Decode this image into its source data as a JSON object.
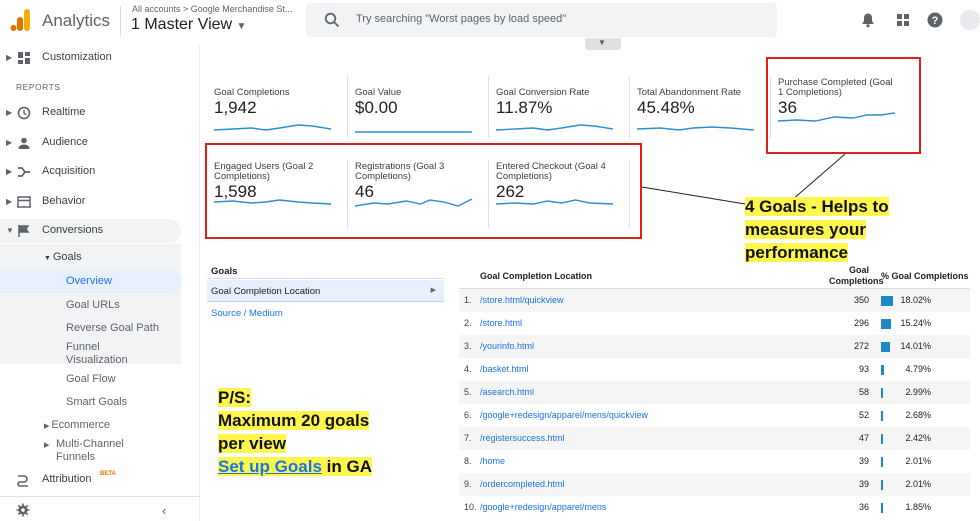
{
  "header": {
    "app_title": "Analytics",
    "breadcrumb": "All accounts  >  Google Merchandise St...",
    "view_name": "1 Master View",
    "search_placeholder": "Try searching \"Worst pages by load speed\""
  },
  "sidebar": {
    "customization": "Customization",
    "reports_heading": "REPORTS",
    "realtime": "Realtime",
    "audience": "Audience",
    "acquisition": "Acquisition",
    "behavior": "Behavior",
    "conversions": "Conversions",
    "goals": "Goals",
    "goal_items": [
      "Overview",
      "Goal URLs",
      "Reverse Goal Path",
      "Funnel Visualization",
      "Goal Flow",
      "Smart Goals"
    ],
    "ecommerce": "Ecommerce",
    "multi_channel": "Multi-Channel Funnels",
    "attribution": "Attribution",
    "beta": "BETA"
  },
  "metrics_row1": [
    {
      "title": "Goal Completions",
      "value": "1,942"
    },
    {
      "title": "Goal Value",
      "value": "$0.00"
    },
    {
      "title": "Goal Conversion Rate",
      "value": "11.87%"
    },
    {
      "title": "Total Abandonment Rate",
      "value": "45.48%"
    },
    {
      "title": "Purchase Completed (Goal 1 Completions)",
      "value": "36"
    }
  ],
  "metrics_row2": [
    {
      "title": "Engaged Users (Goal 2 Completions)",
      "value": "1,598"
    },
    {
      "title": "Registrations (Goal 3 Completions)",
      "value": "46"
    },
    {
      "title": "Entered Checkout (Goal 4 Completions)",
      "value": "262"
    }
  ],
  "left_panel": {
    "heading": "Goals",
    "selected": "Goal Completion Location",
    "link": "Source / Medium"
  },
  "table": {
    "col_location": "Goal Completion Location",
    "col_completions": "Goal Completions",
    "col_pct": "% Goal Completions",
    "rows": [
      {
        "n": "1.",
        "path": "/store.html/quickview",
        "value": "350",
        "pct": "18.02%",
        "frac": 0.1802
      },
      {
        "n": "2.",
        "path": "/store.html",
        "value": "296",
        "pct": "15.24%",
        "frac": 0.1524
      },
      {
        "n": "3.",
        "path": "/yourinfo.html",
        "value": "272",
        "pct": "14.01%",
        "frac": 0.1401
      },
      {
        "n": "4.",
        "path": "/basket.html",
        "value": "93",
        "pct": "4.79%",
        "frac": 0.0479
      },
      {
        "n": "5.",
        "path": "/asearch.html",
        "value": "58",
        "pct": "2.99%",
        "frac": 0.0299
      },
      {
        "n": "6.",
        "path": "/google+redesign/apparel/mens/quickview",
        "value": "52",
        "pct": "2.68%",
        "frac": 0.0268
      },
      {
        "n": "7.",
        "path": "/registersuccess.html",
        "value": "47",
        "pct": "2.42%",
        "frac": 0.0242
      },
      {
        "n": "8.",
        "path": "/home",
        "value": "39",
        "pct": "2.01%",
        "frac": 0.0201
      },
      {
        "n": "9.",
        "path": "/ordercompleted.html",
        "value": "39",
        "pct": "2.01%",
        "frac": 0.0201
      },
      {
        "n": "10.",
        "path": "/google+redesign/apparel/mens",
        "value": "36",
        "pct": "1.85%",
        "frac": 0.0185
      }
    ]
  },
  "annotations": {
    "goals_note": [
      "4 Goals - Helps to",
      "measures your",
      "performance"
    ],
    "ps_line1": "P/S:",
    "ps_line2": "Maximum 20 goals",
    "ps_line3": "per view",
    "ps_link": "Set up Goals",
    "ps_tail": " in GA"
  },
  "colors": {
    "accent": "#1a73e8",
    "sparkline": "#2a8fd0",
    "highlight": "#fdf64c",
    "box": "#e0201b"
  }
}
